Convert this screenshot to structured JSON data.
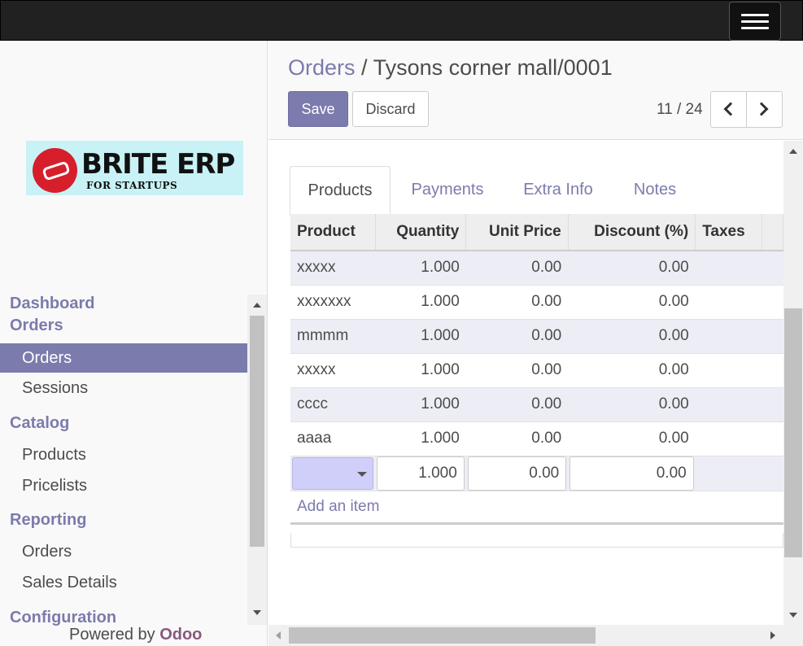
{
  "brand": {
    "logo_title": "BRITE ERP",
    "logo_subtitle": "FOR STARTUPS",
    "powered_prefix": "Powered by",
    "powered_brand": "Odoo"
  },
  "sidebar": {
    "sections": [
      {
        "heading": "Dashboard"
      },
      {
        "heading": "Orders",
        "items": [
          "Orders",
          "Sessions"
        ]
      },
      {
        "heading": "Catalog",
        "items": [
          "Products",
          "Pricelists"
        ]
      },
      {
        "heading": "Reporting",
        "items": [
          "Orders",
          "Sales Details"
        ]
      },
      {
        "heading": "Configuration"
      }
    ],
    "active_item": "Orders"
  },
  "breadcrumb": {
    "parent": "Orders",
    "separator": "/",
    "current": "Tysons corner mall/0001"
  },
  "toolbar": {
    "save_label": "Save",
    "discard_label": "Discard"
  },
  "pager": {
    "value": "11 / 24"
  },
  "tabs": [
    "Products",
    "Payments",
    "Extra Info",
    "Notes"
  ],
  "active_tab": "Products",
  "lines_table": {
    "headers": [
      "Product",
      "Quantity",
      "Unit Price",
      "Discount (%)",
      "Taxes"
    ],
    "rows": [
      [
        "xxxxx",
        "1.000",
        "0.00",
        "0.00",
        ""
      ],
      [
        "xxxxxxx",
        "1.000",
        "0.00",
        "0.00",
        ""
      ],
      [
        "mmmm",
        "1.000",
        "0.00",
        "0.00",
        ""
      ],
      [
        "xxxxx",
        "1.000",
        "0.00",
        "0.00",
        ""
      ],
      [
        "cccc",
        "1.000",
        "0.00",
        "0.00",
        ""
      ],
      [
        "aaaa",
        "1.000",
        "0.00",
        "0.00",
        ""
      ]
    ],
    "edit_row": {
      "quantity": "1.000",
      "unit_price": "0.00",
      "discount": "0.00"
    },
    "add_item_label": "Add an item"
  },
  "colors": {
    "accent": "#7c7bad",
    "topbar": "#212121",
    "odoo_brand": "#875a7b"
  }
}
